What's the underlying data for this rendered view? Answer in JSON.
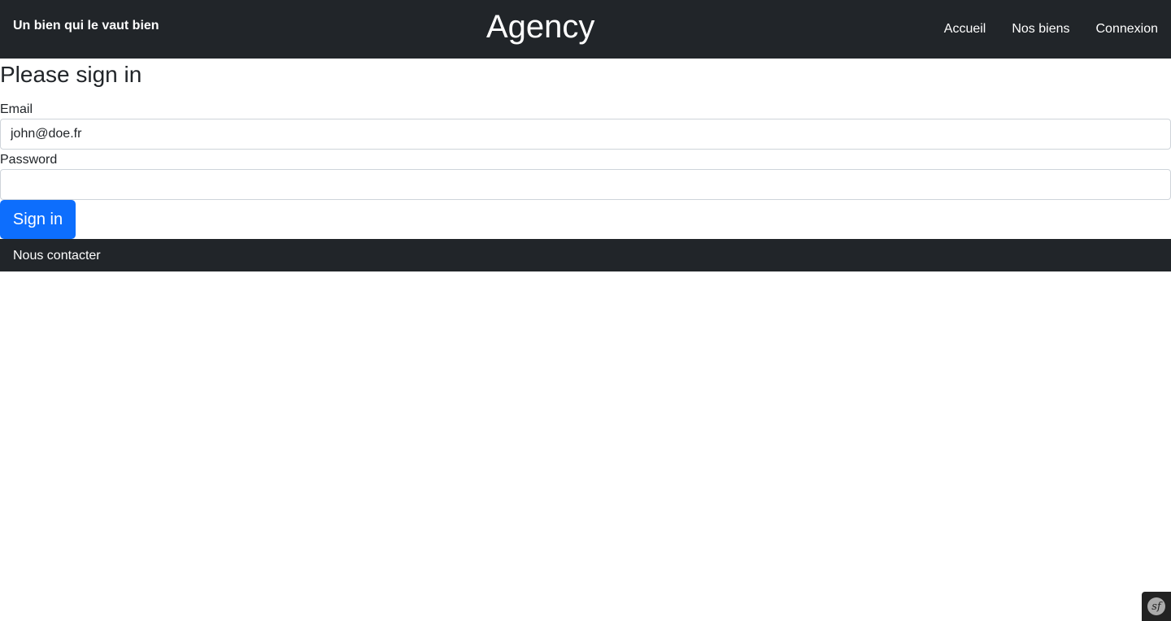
{
  "header": {
    "tagline": "Un bien qui le vaut bien",
    "brand": "Agency",
    "nav": {
      "home": "Accueil",
      "properties": "Nos biens",
      "login": "Connexion"
    }
  },
  "login_form": {
    "title": "Please sign in",
    "email_label": "Email",
    "email_value": "john@doe.fr",
    "password_label": "Password",
    "password_value": "",
    "submit_label": "Sign in"
  },
  "footer": {
    "contact_label": "Nous contacter"
  },
  "debug_toolbar": {
    "logo_icon": "symfony-icon",
    "logo_text": "sf"
  },
  "colors": {
    "navbar_bg": "#212529",
    "primary": "#0d6efd"
  }
}
